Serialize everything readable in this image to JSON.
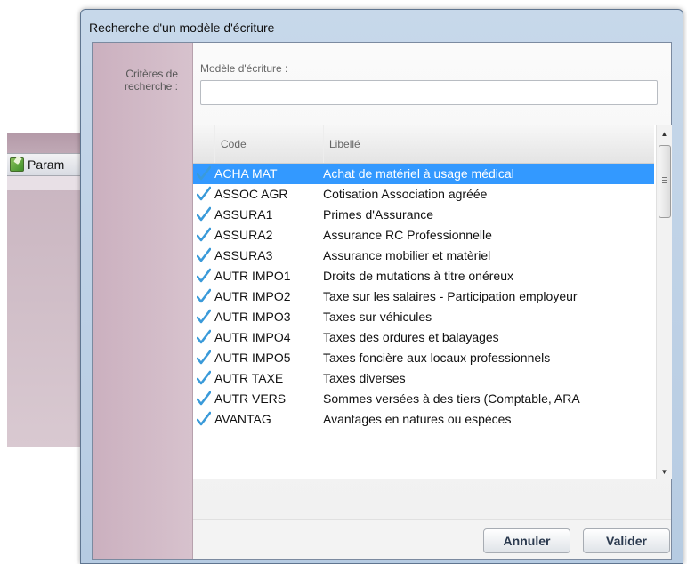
{
  "background_window": {
    "title": "Param"
  },
  "dialog": {
    "title": "Recherche d'un modèle d'écriture",
    "criteria_label": "Critères de\nrecherche :",
    "model_label": "Modèle d'écriture :",
    "model_value": ""
  },
  "table": {
    "columns": [
      "",
      "Code",
      "Libellé"
    ],
    "rows": [
      {
        "code": "ACHA MAT",
        "libelle": "Achat de matériel à usage médical",
        "selected": true
      },
      {
        "code": "ASSOC AGR",
        "libelle": "Cotisation Association agréée",
        "selected": false
      },
      {
        "code": "ASSURA1",
        "libelle": "Primes d'Assurance",
        "selected": false
      },
      {
        "code": "ASSURA2",
        "libelle": "Assurance RC Professionnelle",
        "selected": false
      },
      {
        "code": "ASSURA3",
        "libelle": "Assurance mobilier et matèriel",
        "selected": false
      },
      {
        "code": "AUTR IMPO1",
        "libelle": "Droits de mutations à titre onéreux",
        "selected": false
      },
      {
        "code": "AUTR IMPO2",
        "libelle": "Taxe sur les salaires - Participation employeur",
        "selected": false
      },
      {
        "code": "AUTR IMPO3",
        "libelle": "Taxes sur véhicules",
        "selected": false
      },
      {
        "code": "AUTR IMPO4",
        "libelle": "Taxes des ordures et balayages",
        "selected": false
      },
      {
        "code": "AUTR IMPO5",
        "libelle": "Taxes foncière aux locaux professionnels",
        "selected": false
      },
      {
        "code": "AUTR TAXE",
        "libelle": "Taxes diverses",
        "selected": false
      },
      {
        "code": "AUTR VERS",
        "libelle": "Sommes versées à des tiers (Comptable, ARA",
        "selected": false
      },
      {
        "code": "AVANTAG",
        "libelle": "Avantages en natures ou espèces",
        "selected": false
      }
    ]
  },
  "buttons": {
    "cancel": "Annuler",
    "validate": "Valider"
  },
  "colors": {
    "selection": "#3399ff",
    "check": "#3a9ad9"
  }
}
